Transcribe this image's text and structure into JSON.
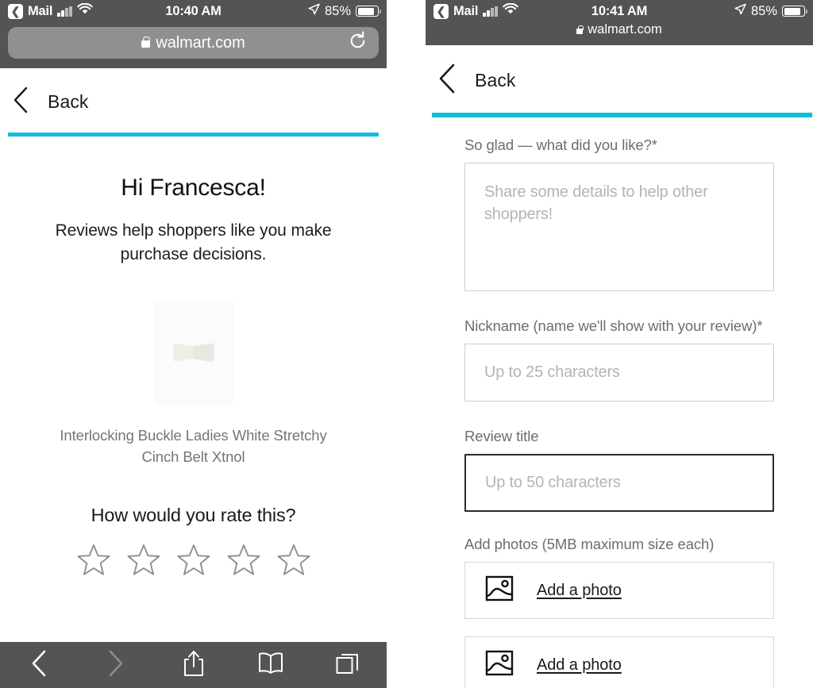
{
  "left_panel": {
    "status_bar": {
      "back_app": "Mail",
      "back_icon": "chevron-left-icon",
      "signal_icon": "cellular-signal-icon",
      "wifi_icon": "wifi-icon",
      "time": "10:40 AM",
      "location_icon": "location-arrow-icon",
      "battery_percent": "85%",
      "battery_icon": "battery-icon",
      "battery_level": 85
    },
    "url_bar": {
      "lock_icon": "lock-icon",
      "url": "walmart.com",
      "reload_icon": "reload-icon"
    },
    "nav": {
      "back_icon": "chevron-left-icon",
      "back_label": "Back"
    },
    "progress_color": "#10bedc",
    "content": {
      "greeting": "Hi Francesca!",
      "subtitle": "Reviews help shoppers like you make purchase decisions.",
      "product_image_alt": "white interlocking belt buckle",
      "product_title": "Interlocking Buckle Ladies White Stretchy Cinch Belt Xtnol",
      "rating_question": "How would you rate this?",
      "rating_value": 0,
      "rating_max": 5,
      "star_icon": "star-outline-icon"
    },
    "toolbar": {
      "back_icon": "chevron-left-icon",
      "forward_icon": "chevron-right-icon",
      "share_icon": "share-icon",
      "bookmarks_icon": "book-icon",
      "tabs_icon": "tabs-icon"
    }
  },
  "right_panel": {
    "status_bar": {
      "back_app": "Mail",
      "back_icon": "chevron-left-icon",
      "signal_icon": "cellular-signal-icon",
      "wifi_icon": "wifi-icon",
      "time": "10:41 AM",
      "location_icon": "location-arrow-icon",
      "battery_percent": "85%",
      "battery_icon": "battery-icon",
      "battery_level": 85
    },
    "url_bar": {
      "lock_icon": "lock-icon",
      "url": "walmart.com"
    },
    "nav": {
      "back_icon": "chevron-left-icon",
      "back_label": "Back"
    },
    "progress_color": "#10bedc",
    "form": {
      "review_text": {
        "label": "So glad — what did you like?*",
        "placeholder": "Share some details to help other shoppers!",
        "value": ""
      },
      "nickname": {
        "label": "Nickname (name we'll show with your review)*",
        "placeholder": "Up to 25 characters",
        "value": ""
      },
      "review_title": {
        "label": "Review title",
        "placeholder": "Up to 50 characters",
        "value": "",
        "focused": true
      },
      "photos": {
        "label": "Add photos (5MB maximum size each)",
        "photo_icon": "image-placeholder-icon",
        "buttons": [
          {
            "label": "Add a photo"
          },
          {
            "label": "Add a photo"
          }
        ]
      }
    }
  }
}
